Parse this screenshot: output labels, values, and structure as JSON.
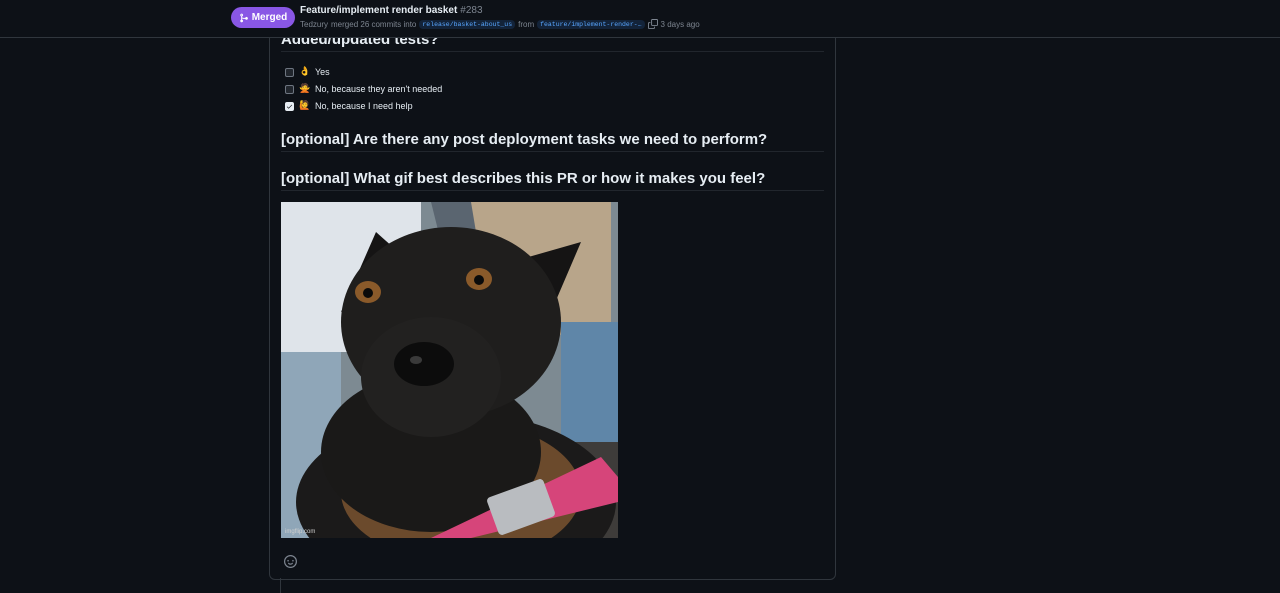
{
  "header": {
    "status_label": "Merged",
    "pr_title": "Feature/implement render basket",
    "pr_number": "#283",
    "author": "Tedzury",
    "merge_text": "merged 26 commits into",
    "base_branch": "release/basket-about_us",
    "from_text": "from",
    "head_branch": "feature/implement-render-…",
    "time_ago": "3 days ago",
    "status_color": "#8957e5"
  },
  "comment": {
    "tests_heading": "Added/updated tests?",
    "tasks": [
      {
        "emoji": "👌",
        "label": "Yes",
        "checked": false
      },
      {
        "emoji": "🙅",
        "label": "No, because they aren't needed",
        "checked": false
      },
      {
        "emoji": "🙋",
        "label": "No, because I need help",
        "checked": true
      }
    ],
    "post_deploy_heading": "[optional] Are there any post deployment tasks we need to perform?",
    "gif_heading": "[optional] What gif best describes this PR or how it makes you feel?",
    "gif_watermark": "imgflip.com",
    "reaction_icon": "smiley-icon"
  }
}
